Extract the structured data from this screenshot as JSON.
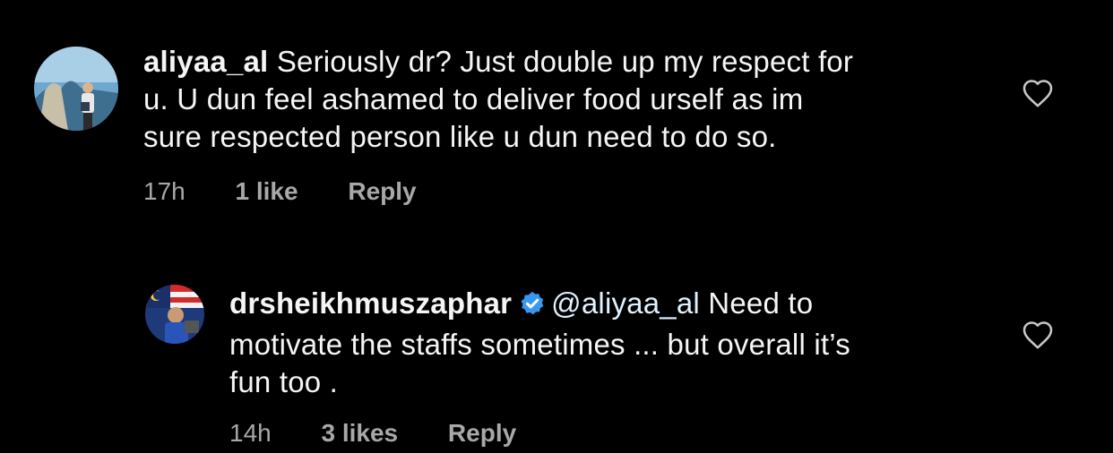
{
  "comments": [
    {
      "username": "aliyaa_al",
      "text": "Seriously dr? Just double up my respect for u. U dun feel ashamed to deliver food urself as im sure respected person like u dun need to do so.",
      "lines": [
        "Seriously dr? Just double up my respect for",
        "u. U dun feel ashamed to deliver food urself as im",
        "sure respected person like u dun need to do so."
      ],
      "time": "17h",
      "likes": "1 like",
      "reply_label": "Reply",
      "avatar_icon": "profile-photo"
    },
    {
      "username": "drsheikhmuszaphar",
      "verified": true,
      "mention": "@aliyaa_al",
      "line1_rest": " Need to",
      "line2": "motivate the staffs sometimes ... but overall it’s",
      "line3": "fun too .",
      "time": "14h",
      "likes": "3 likes",
      "reply_label": "Reply",
      "avatar_icon": "profile-photo"
    }
  ],
  "icons": {
    "like": "heart-outline-icon",
    "verified": "verified-badge-icon"
  },
  "colors": {
    "background": "#000000",
    "text": "#f5f5f5",
    "meta": "#a8a8a8",
    "mention": "#e0f1ff",
    "verified": "#3897f0"
  }
}
